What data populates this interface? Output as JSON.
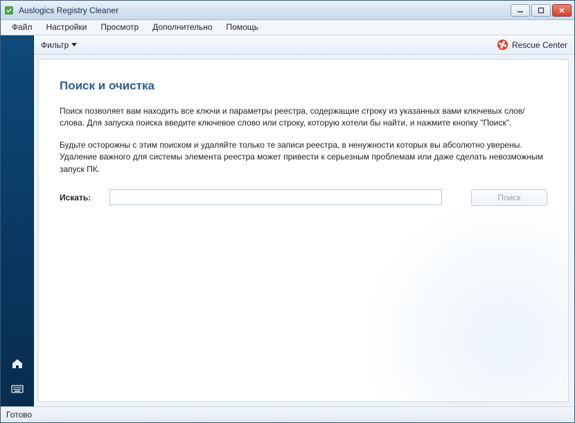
{
  "window": {
    "title": "Auslogics Registry Cleaner"
  },
  "menu": {
    "items": [
      "Файл",
      "Настройки",
      "Просмотр",
      "Дополнительно",
      "Помощь"
    ]
  },
  "toolbar": {
    "filter_label": "Фильтр",
    "rescue_label": "Rescue Center"
  },
  "page": {
    "title": "Поиск и очистка",
    "paragraph1": "Поиск позволяет вам находить все ключи и параметры реестра, содержащие строку из указанных вами ключевых слов/слова. Для запуска поиска введите ключевое слово или строку, которую хотели бы найти, и нажмите кнопку \"Поиск\".",
    "paragraph2": "Будьте осторожны с этим поиском и удаляйте только те записи реестра, в ненужности которых вы абсолютно уверены. Удаление важного для системы элемента реестра может привести к серьезным проблемам или даже сделать невозможным запуск ПК.",
    "search_label": "Искать:",
    "search_value": "",
    "search_button": "Поиск"
  },
  "status": {
    "text": "Готово"
  }
}
